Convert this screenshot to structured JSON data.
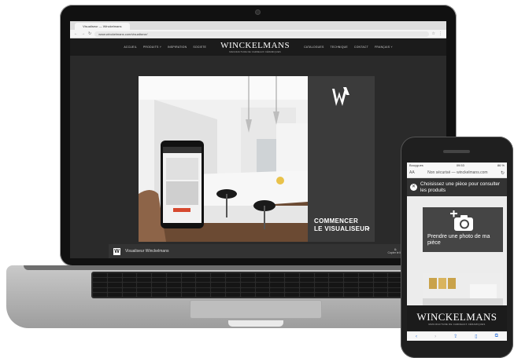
{
  "laptop": {
    "browser": {
      "tab_title": "Visualiseur — Winckelmans",
      "url": "www.winckelmans.com/visualiseur/"
    },
    "site_nav": {
      "left_items": [
        "ACCUEIL",
        "PRODUITS ˅",
        "INSPIRATION",
        "SOCIETE"
      ],
      "right_items": [
        "CATALOGUES",
        "TECHNIQUE",
        "CONTACT",
        "FRANÇAIS ˅"
      ],
      "brand_name": "WINCKELMANS",
      "brand_tagline": "MANUFACTURE DE CARREAUX CÉRAMIQUES"
    },
    "hero": {
      "cta_line1": "COMMENCER",
      "cta_line2": "LE VISUALISEUR"
    },
    "footer": {
      "label": "Visualiseur Winckelmans",
      "right_label": "Copier le li..."
    }
  },
  "phone": {
    "status": {
      "carrier": "Bouygues",
      "time": "09:53",
      "battery": "86 %"
    },
    "safari": {
      "aa_label": "AA",
      "url": "Non sécurisé — winckelmans.com"
    },
    "header_text": "Choisissez une pièce pour consulter les produits",
    "photo_card_label": "Prendre une photo de ma pièce",
    "brand_name": "WINCKELMANS",
    "brand_tagline": "MANUFACTURE DE CARREAUX CÉRAMIQUES",
    "toolbar_icons": [
      "back-icon",
      "forward-icon",
      "share-icon",
      "bookmarks-icon",
      "tabs-icon"
    ]
  },
  "colors": {
    "dark_panel": "#3b3b3b",
    "site_bg": "#2a2a2a",
    "ios_blue": "#2a6fdb"
  }
}
